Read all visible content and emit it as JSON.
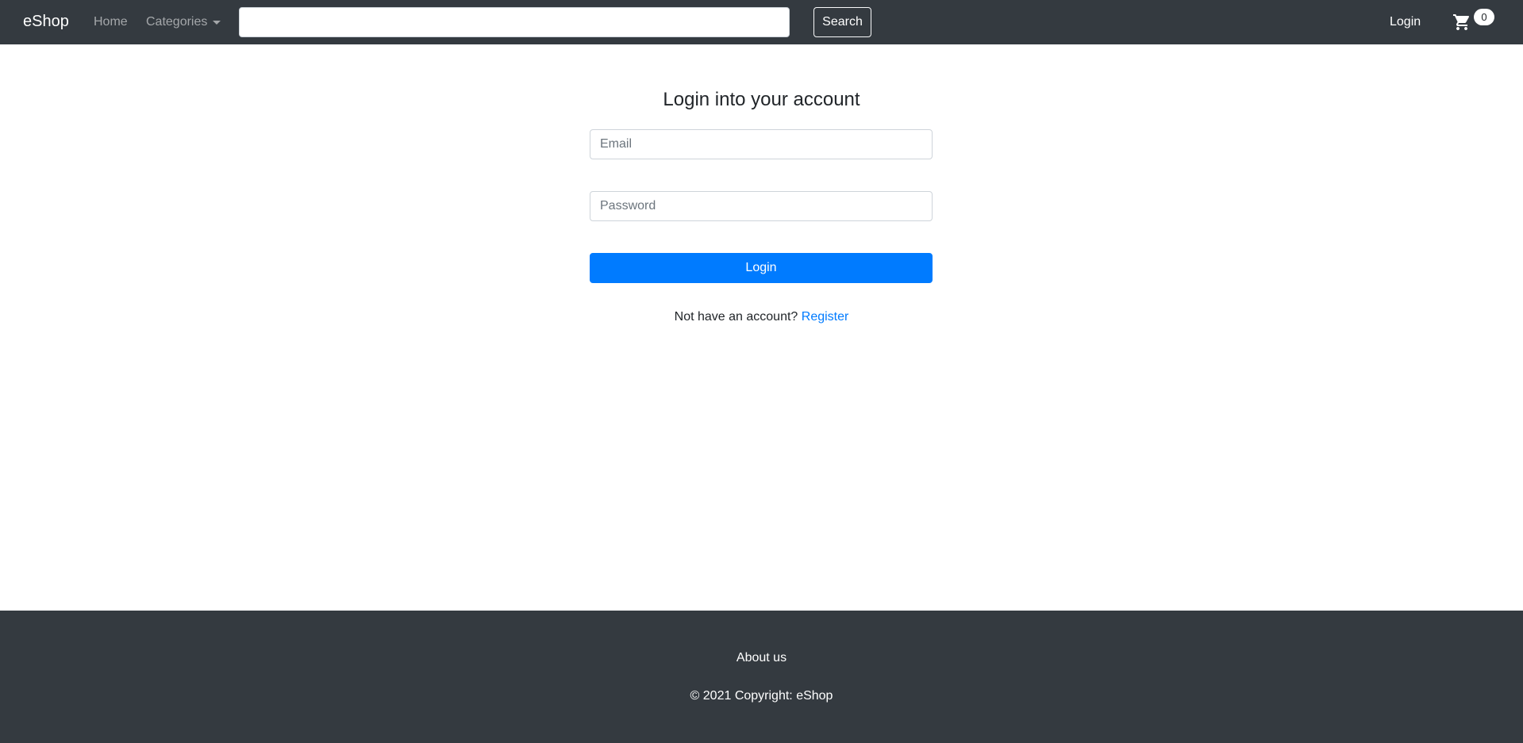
{
  "navbar": {
    "brand": "eShop",
    "home_label": "Home",
    "categories_label": "Categories",
    "search_value": "",
    "search_button_label": "Search",
    "login_label": "Login",
    "cart_count": "0"
  },
  "login": {
    "title": "Login into your account",
    "email_placeholder": "Email",
    "password_placeholder": "Password",
    "submit_label": "Login",
    "register_prompt": "Not have an account?",
    "register_link": "Register"
  },
  "footer": {
    "about_label": "About us",
    "copyright": "© 2021 Copyright: eShop"
  },
  "colors": {
    "navbar_bg": "#343a40",
    "primary": "#007bff",
    "footer_bg": "#343a40"
  },
  "icons": {
    "cart": "cart-icon",
    "dropdown": "caret-down-icon"
  }
}
